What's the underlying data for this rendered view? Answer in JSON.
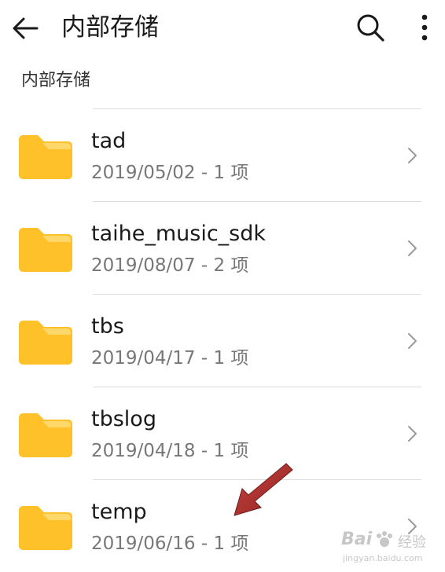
{
  "header": {
    "title": "内部存储",
    "back_icon": "arrow-left-icon",
    "search_icon": "search-icon",
    "more_icon": "more-vertical-icon"
  },
  "breadcrumb": {
    "path": "内部存储"
  },
  "colors": {
    "folder": "#FFC12A",
    "folder_tab": "#FFD86B",
    "annotation_arrow": "#A8302E"
  },
  "files": [
    {
      "name": "tad",
      "meta": "2019/05/02 - 1 项"
    },
    {
      "name": "taihe_music_sdk",
      "meta": "2019/08/07 - 2 项"
    },
    {
      "name": "tbs",
      "meta": "2019/04/17 - 1 项"
    },
    {
      "name": "tbslog",
      "meta": "2019/04/18 - 1 项"
    },
    {
      "name": "temp",
      "meta": "2019/06/16 - 1 项"
    }
  ],
  "watermark": {
    "brand": "Bai",
    "brand_cn": "经验",
    "url": "jingyan.baidu.com"
  }
}
